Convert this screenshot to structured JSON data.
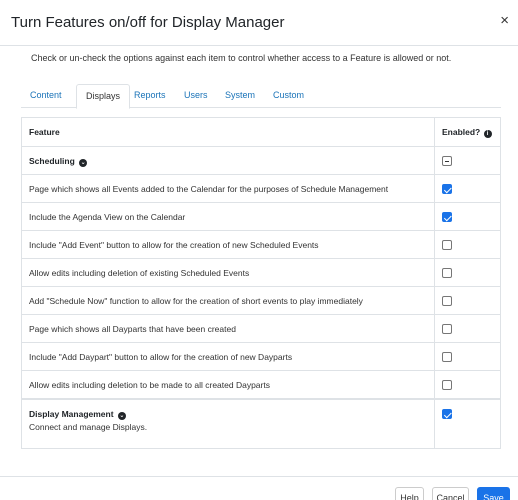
{
  "modal": {
    "title": "Turn Features on/off for Display Manager",
    "close_glyph": "×",
    "description": "Check or un-check the options against each item to control whether access to a Feature is allowed or not."
  },
  "tabs": [
    {
      "label": "Content",
      "active": false
    },
    {
      "label": "Displays",
      "active": true
    },
    {
      "label": "Reports",
      "active": false
    },
    {
      "label": "Users",
      "active": false
    },
    {
      "label": "System",
      "active": false
    },
    {
      "label": "Custom",
      "active": false
    }
  ],
  "table": {
    "header_feature": "Feature",
    "header_enabled": "Enabled?",
    "info_glyph": "i",
    "collapse_glyph": "⌄",
    "groups": [
      {
        "title": "Scheduling",
        "state": "indeterminate",
        "items": [
          {
            "label": "Page which shows all Events added to the Calendar for the purposes of Schedule Management",
            "checked": true
          },
          {
            "label": "Include the Agenda View on the Calendar",
            "checked": true
          },
          {
            "label": "Include \"Add Event\" button to allow for the creation of new Scheduled Events",
            "checked": false
          },
          {
            "label": "Allow edits including deletion of existing Scheduled Events",
            "checked": false
          },
          {
            "label": "Add \"Schedule Now\" function to allow for the creation of short events to play immediately",
            "checked": false
          },
          {
            "label": "Page which shows all Dayparts that have been created",
            "checked": false
          },
          {
            "label": "Include \"Add Daypart\" button to allow for the creation of new Dayparts",
            "checked": false
          },
          {
            "label": "Allow edits including deletion to be made to all created Dayparts",
            "checked": false
          }
        ]
      },
      {
        "title": "Display Management",
        "subtitle": "Connect and manage Displays.",
        "state": "checked",
        "items": []
      }
    ]
  },
  "footer": {
    "help_label": "Help",
    "cancel_label": "Cancel",
    "save_label": "Save"
  },
  "colors": {
    "accent": "#1a73e8",
    "link": "#1a73b8",
    "border": "#dee2e6"
  }
}
